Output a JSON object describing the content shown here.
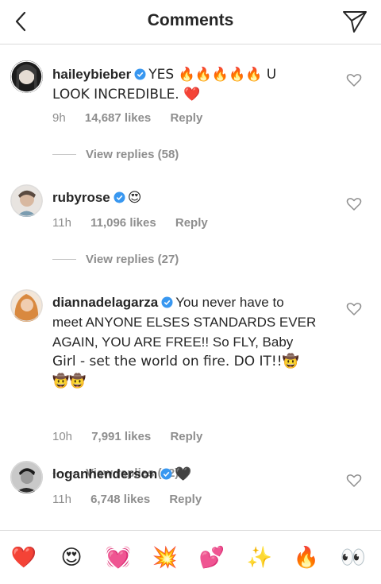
{
  "header": {
    "title": "Comments"
  },
  "comments": [
    {
      "username": "haileybieber",
      "text_line1": "YES 🔥🔥🔥🔥🔥 U",
      "text_line2": "LOOK INCREDIBLE. ❤️",
      "time": "9h",
      "likes": "14,687 likes",
      "reply": "Reply",
      "view_replies": "View replies (58)"
    },
    {
      "username": "rubyrose",
      "text_line1": "😍",
      "time": "11h",
      "likes": "11,096 likes",
      "reply": "Reply",
      "view_replies": "View replies (27)"
    },
    {
      "username": "diannadelagarza",
      "text_line1": "You never have to",
      "text_line2": "meet ANYONE ELSES STANDARDS EVER",
      "text_line3": "AGAIN, YOU ARE FREE!! So FLY, Baby",
      "text_line4": "Girl - set the world on fire. DO IT!!🤠",
      "text_line5": "🤠🤠",
      "time": "10h",
      "likes": "7,991 likes",
      "reply": "Reply",
      "view_replies": "View replies (62)"
    },
    {
      "username": "loganhenderson",
      "text_line1": "🖤",
      "time": "11h",
      "likes": "6,748 likes",
      "reply": "Reply"
    }
  ],
  "emoji_bar": [
    "❤️",
    "😍",
    "💓",
    "💥",
    "💕",
    "✨",
    "🔥",
    "👀"
  ],
  "colors": {
    "verified": "#3897f0",
    "muted": "#8e8e8e",
    "text": "#262626"
  }
}
